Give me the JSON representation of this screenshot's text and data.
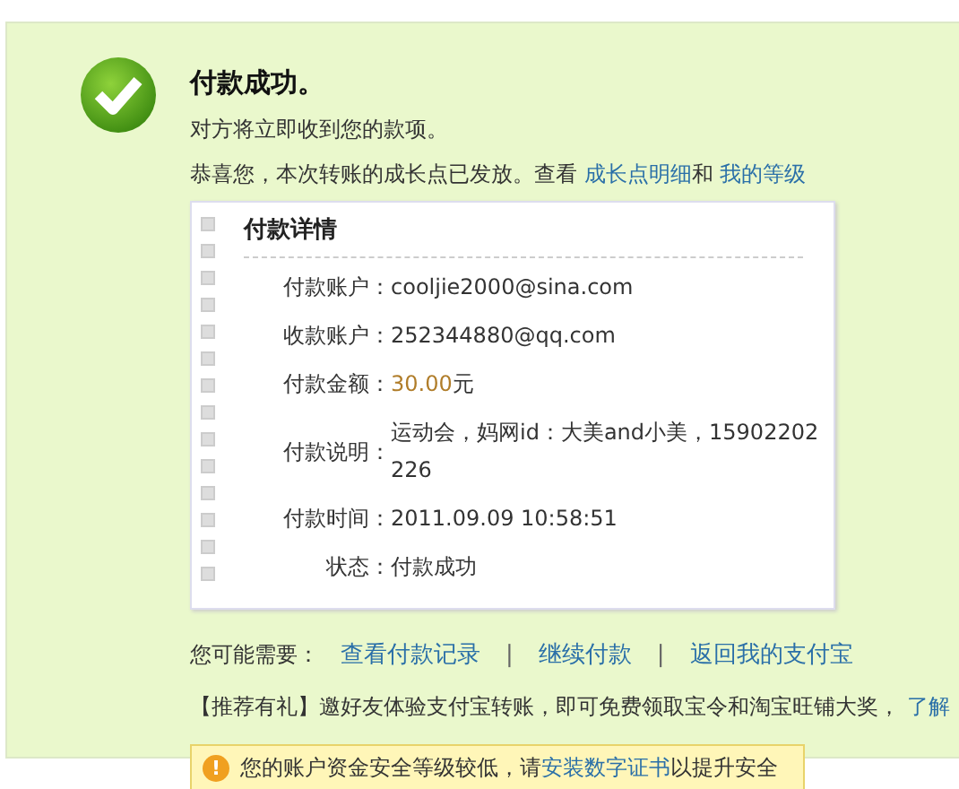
{
  "result": {
    "title": "付款成功。",
    "message": "对方将立即收到您的款项。",
    "growth": {
      "text": "恭喜您，本次转账的成长点已发放。查看",
      "link1": "成长点明细",
      "joiner": "和",
      "link2": "我的等级"
    }
  },
  "details": {
    "title": "付款详情",
    "rows": [
      {
        "label": "付款账户：",
        "value": "cooljie2000@sina.com",
        "kind": "plain"
      },
      {
        "label": "收款账户：",
        "value": "252344880@qq.com",
        "kind": "plain"
      },
      {
        "label": "付款金额：",
        "value": "30.00",
        "unit": "元",
        "kind": "amount"
      },
      {
        "label": "付款说明：",
        "value": "运动会，妈网id：大美and小美，15902202226",
        "kind": "plain"
      },
      {
        "label": "付款时间：",
        "value": "2011.09.09 10:58:51",
        "kind": "plain"
      },
      {
        "label": "状态：",
        "value": "付款成功",
        "kind": "plain"
      }
    ]
  },
  "actions": {
    "label": "您可能需要：",
    "links": [
      "查看付款记录",
      "继续付款",
      "返回我的支付宝"
    ],
    "separator": "|"
  },
  "promo": {
    "text": "【推荐有礼】邀好友体验支付宝转账，即可免费领取宝令和淘宝旺铺大奖，",
    "link": "了解"
  },
  "warning": {
    "icon": "!",
    "text": "您的账户资金安全等级较低，请",
    "link": "安装数字证书",
    "tail": "以提升安全"
  }
}
